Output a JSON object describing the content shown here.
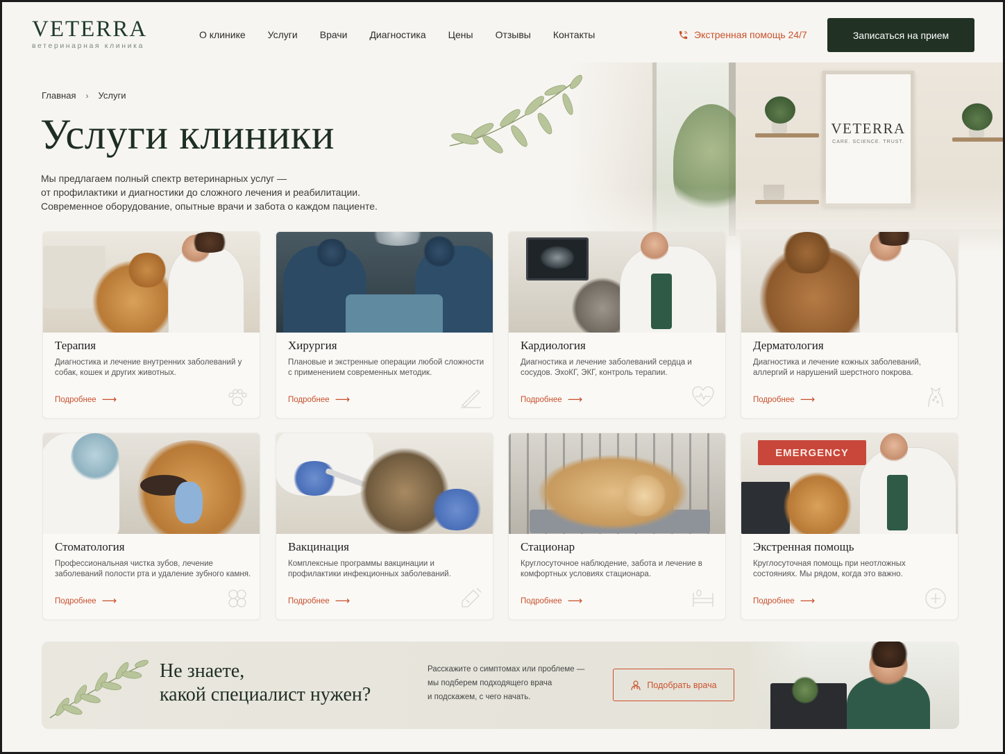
{
  "header": {
    "logo_title": "VETERRA",
    "logo_subtitle": "ветеринарная клиника",
    "nav": [
      "О клинике",
      "Услуги",
      "Врачи",
      "Диагностика",
      "Цены",
      "Отзывы",
      "Контакты"
    ],
    "emergency_label": "Экстренная помощь 24/7",
    "cta_label": "Записаться на прием"
  },
  "hero": {
    "sign_title": "VETERRA",
    "sign_subtitle": "CARE. SCIENCE. TRUST."
  },
  "breadcrumb": {
    "home": "Главная",
    "separator": "›",
    "current": "Услуги"
  },
  "page": {
    "title": "Услуги клиники",
    "intro_lines": [
      "Мы предлагаем полный спектр ветеринарных услуг —",
      "от профилактики и диагностики до сложного лечения и реабилитации.",
      "Современное оборудование, опытные врачи и забота о каждом пациенте."
    ]
  },
  "services": [
    {
      "title": "Терапия",
      "desc": "Диагностика и лечение внутренних заболеваний у собак, кошек и других животных.",
      "link": "Подробнее",
      "icon": "paw-icon"
    },
    {
      "title": "Хирургия",
      "desc": "Плановые и экстренные операции любой сложности с применением современных методик.",
      "link": "Подробнее",
      "icon": "scalpel-icon"
    },
    {
      "title": "Кардиология",
      "desc": "Диагностика и лечение заболеваний сердца и сосудов. ЭхоКГ, ЭКГ, контроль терапии.",
      "link": "Подробнее",
      "icon": "heart-pulse-icon"
    },
    {
      "title": "Дерматология",
      "desc": "Диагностика и лечение кожных заболеваний, аллергий и нарушений шерстного покрова.",
      "link": "Подробнее",
      "icon": "dog-skin-icon"
    },
    {
      "title": "Стоматология",
      "desc": "Профессиональная чистка зубов, лечение заболеваний полости рта и удаление зубного камня.",
      "link": "Подробнее",
      "icon": "tooth-icon"
    },
    {
      "title": "Вакцинация",
      "desc": "Комплексные программы вакцинации и профилактики инфекционных заболеваний.",
      "link": "Подробнее",
      "icon": "syringe-icon"
    },
    {
      "title": "Стационар",
      "desc": "Круглосуточное наблюдение, забота и лечение в комфортных условиях стационара.",
      "link": "Подробнее",
      "icon": "bed-icon"
    },
    {
      "title": "Экстренная помощь",
      "desc": "Круглосуточная помощь при неотложных состояниях. Мы рядом, когда это важно.",
      "link": "Подробнее",
      "icon": "emergency-icon"
    }
  ],
  "emergency_sign": "EMERGENCY",
  "banner": {
    "title_lines": [
      "Не знаете,",
      "какой специалист нужен?"
    ],
    "text_lines": [
      "Расскажите о симптомах или проблеме —",
      "мы подберем подходящего врача",
      "и подскажем, с чего начать."
    ],
    "button_label": "Подобрать врача"
  },
  "colors": {
    "accent": "#c9502c",
    "brand_dark": "#213124",
    "background": "#f7f5f1"
  }
}
